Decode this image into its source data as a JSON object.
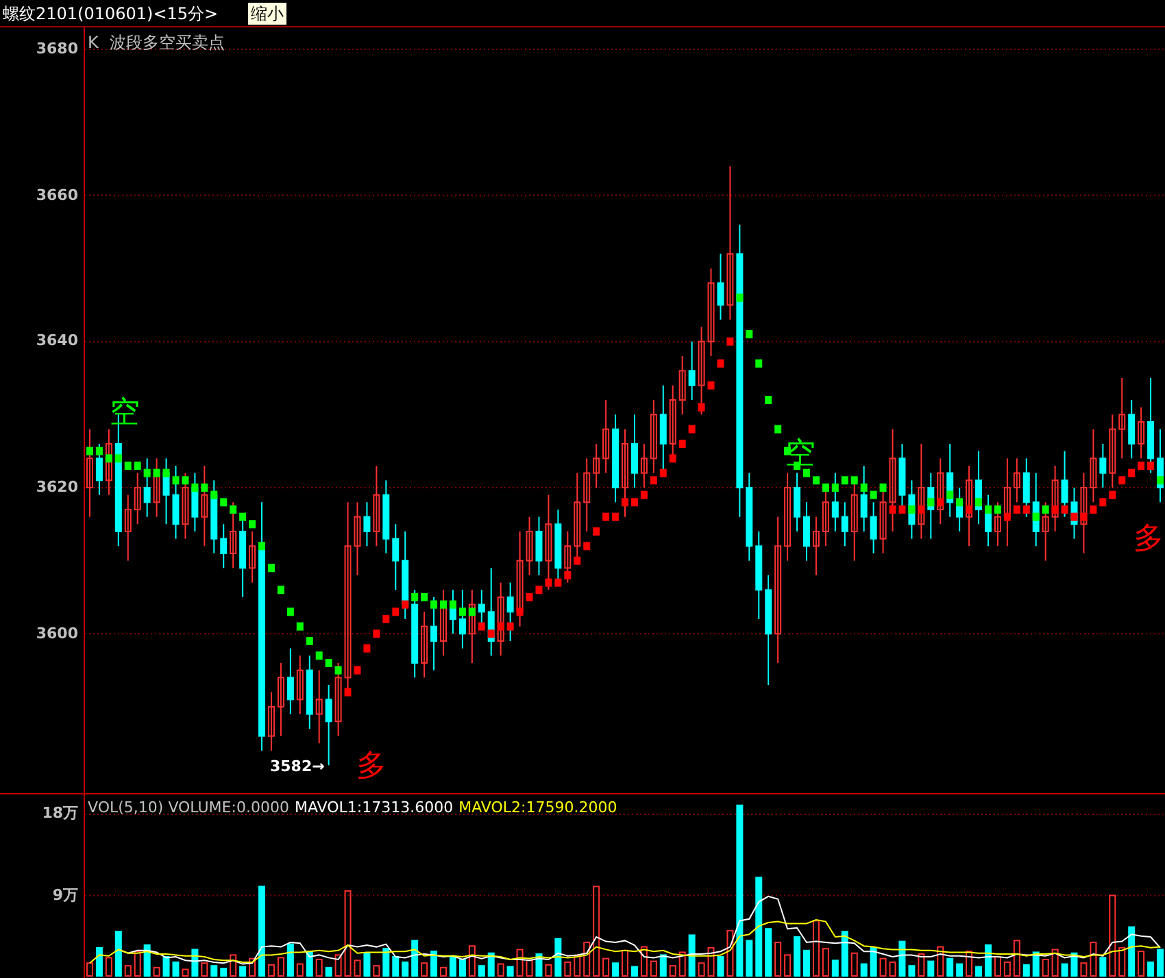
{
  "title_bar": {
    "title": "螺纹2101(010601)<15分>",
    "button": "缩小"
  },
  "price_panel": {
    "indicator_label": "K",
    "indicator_name": "波段多空买卖点",
    "low_marker": "3582→",
    "signals": [
      {
        "kind": "short",
        "text": "空"
      },
      {
        "kind": "long",
        "text": "多"
      },
      {
        "kind": "short",
        "text": "空"
      },
      {
        "kind": "long",
        "text": "多"
      }
    ],
    "chart_data": {
      "type": "candlestick",
      "ylim": [
        3578,
        3683
      ],
      "yticks": [
        3680,
        3660,
        3640,
        3620,
        3600
      ],
      "grid": true,
      "series": [
        {
          "type": "scatter",
          "color": "#00ff00",
          "values": [
            3625,
            3625,
            3624,
            3624,
            3623,
            3623,
            3622,
            3622,
            3622,
            3621,
            3621,
            3620,
            3620,
            3619,
            3618,
            3617,
            3616,
            3615,
            3612,
            3609,
            3606,
            3603,
            3601,
            3599,
            3597,
            3596,
            3595,
            null,
            null,
            null,
            null,
            null,
            null,
            null,
            3605,
            3605,
            3604,
            3604,
            3604,
            3603,
            3603,
            null,
            null,
            null,
            null,
            null,
            null,
            null,
            null,
            null,
            null,
            null,
            null,
            null,
            null,
            null,
            null,
            null,
            null,
            null,
            null,
            null,
            null,
            null,
            null,
            null,
            null,
            null,
            3646,
            3641,
            3637,
            3632,
            3628,
            3625,
            3623,
            3622,
            3621,
            3620,
            3620,
            3621,
            3621,
            3620,
            3619,
            3620,
            null,
            null,
            3617,
            null,
            3618,
            null,
            3619,
            3618,
            null,
            3618,
            3617,
            3617,
            null,
            null,
            null,
            3616,
            3617,
            null,
            null,
            null,
            null,
            null,
            null,
            null,
            null,
            null,
            null,
            null,
            3621
          ]
        },
        {
          "type": "scatter",
          "color": "#ff0000",
          "values": [
            null,
            null,
            null,
            null,
            null,
            null,
            null,
            null,
            null,
            null,
            null,
            null,
            null,
            null,
            null,
            null,
            null,
            null,
            null,
            null,
            null,
            null,
            null,
            null,
            null,
            null,
            null,
            3592,
            3595,
            3598,
            3600,
            3602,
            3603,
            3604,
            null,
            null,
            null,
            null,
            null,
            null,
            null,
            3601,
            3600,
            3601,
            3601,
            3603,
            3605,
            3606,
            3607,
            3607,
            3608,
            3610,
            3612,
            3614,
            3616,
            3616,
            3618,
            3618,
            3619,
            3621,
            3622,
            3624,
            3626,
            3628,
            3631,
            3634,
            3637,
            3640,
            null,
            null,
            null,
            null,
            null,
            null,
            null,
            null,
            null,
            null,
            null,
            null,
            null,
            null,
            null,
            null,
            3617,
            3617,
            null,
            3617,
            null,
            3618,
            null,
            null,
            3617,
            null,
            null,
            null,
            3616,
            3617,
            3617,
            null,
            null,
            3617,
            3617,
            3616,
            3616,
            3617,
            3618,
            3619,
            3621,
            3622,
            3623,
            3623,
            null
          ]
        }
      ],
      "ohlc": [
        [
          3620,
          3628,
          3616,
          3624
        ],
        [
          3624,
          3626,
          3619,
          3621
        ],
        [
          3621,
          3628,
          3619,
          3626
        ],
        [
          3626,
          3630,
          3612,
          3614
        ],
        [
          3614,
          3619,
          3610,
          3617
        ],
        [
          3617,
          3622,
          3615,
          3620
        ],
        [
          3620,
          3624,
          3616,
          3618
        ],
        [
          3618,
          3624,
          3616,
          3622
        ],
        [
          3622,
          3624,
          3615,
          3619
        ],
        [
          3619,
          3623,
          3613,
          3615
        ],
        [
          3615,
          3622,
          3613,
          3620
        ],
        [
          3620,
          3622,
          3614,
          3616
        ],
        [
          3616,
          3623,
          3612,
          3619
        ],
        [
          3619,
          3621,
          3611,
          3613
        ],
        [
          3613,
          3615,
          3609,
          3611
        ],
        [
          3611,
          3618,
          3609,
          3614
        ],
        [
          3614,
          3616,
          3605,
          3609
        ],
        [
          3609,
          3614,
          3607,
          3612
        ],
        [
          3612,
          3618,
          3584,
          3586
        ],
        [
          3586,
          3592,
          3584,
          3590
        ],
        [
          3590,
          3596,
          3586,
          3594
        ],
        [
          3594,
          3598,
          3589,
          3591
        ],
        [
          3591,
          3597,
          3589,
          3595
        ],
        [
          3595,
          3597,
          3587,
          3589
        ],
        [
          3589,
          3595,
          3585,
          3591
        ],
        [
          3591,
          3593,
          3582,
          3588
        ],
        [
          3588,
          3596,
          3586,
          3594
        ],
        [
          3594,
          3618,
          3592,
          3612
        ],
        [
          3612,
          3618,
          3608,
          3616
        ],
        [
          3616,
          3618,
          3612,
          3614
        ],
        [
          3614,
          3623,
          3612,
          3619
        ],
        [
          3619,
          3621,
          3611,
          3613
        ],
        [
          3613,
          3615,
          3606,
          3610
        ],
        [
          3610,
          3614,
          3602,
          3604
        ],
        [
          3604,
          3606,
          3594,
          3596
        ],
        [
          3596,
          3603,
          3594,
          3601
        ],
        [
          3601,
          3605,
          3595,
          3599
        ],
        [
          3599,
          3606,
          3597,
          3604
        ],
        [
          3604,
          3606,
          3600,
          3602
        ],
        [
          3602,
          3606,
          3598,
          3600
        ],
        [
          3600,
          3606,
          3596,
          3604
        ],
        [
          3604,
          3606,
          3601,
          3603
        ],
        [
          3603,
          3609,
          3597,
          3599
        ],
        [
          3599,
          3607,
          3597,
          3605
        ],
        [
          3605,
          3607,
          3599,
          3603
        ],
        [
          3603,
          3614,
          3601,
          3610
        ],
        [
          3610,
          3616,
          3608,
          3614
        ],
        [
          3614,
          3616,
          3608,
          3610
        ],
        [
          3610,
          3619,
          3606,
          3615
        ],
        [
          3615,
          3617,
          3607,
          3609
        ],
        [
          3609,
          3614,
          3607,
          3612
        ],
        [
          3612,
          3622,
          3610,
          3618
        ],
        [
          3618,
          3624,
          3614,
          3622
        ],
        [
          3622,
          3626,
          3620,
          3624
        ],
        [
          3624,
          3632,
          3622,
          3628
        ],
        [
          3628,
          3630,
          3618,
          3620
        ],
        [
          3620,
          3628,
          3616,
          3626
        ],
        [
          3626,
          3630,
          3620,
          3622
        ],
        [
          3622,
          3626,
          3620,
          3624
        ],
        [
          3624,
          3632,
          3622,
          3630
        ],
        [
          3630,
          3634,
          3622,
          3626
        ],
        [
          3626,
          3634,
          3624,
          3632
        ],
        [
          3632,
          3638,
          3630,
          3636
        ],
        [
          3636,
          3640,
          3632,
          3634
        ],
        [
          3634,
          3642,
          3630,
          3640
        ],
        [
          3640,
          3650,
          3638,
          3648
        ],
        [
          3648,
          3652,
          3643,
          3645
        ],
        [
          3645,
          3664,
          3643,
          3652
        ],
        [
          3652,
          3656,
          3616,
          3620
        ],
        [
          3620,
          3622,
          3610,
          3612
        ],
        [
          3612,
          3614,
          3602,
          3606
        ],
        [
          3606,
          3608,
          3593,
          3600
        ],
        [
          3600,
          3616,
          3596,
          3612
        ],
        [
          3612,
          3622,
          3610,
          3620
        ],
        [
          3620,
          3622,
          3614,
          3616
        ],
        [
          3616,
          3618,
          3610,
          3612
        ],
        [
          3612,
          3616,
          3608,
          3614
        ],
        [
          3614,
          3620,
          3612,
          3618
        ],
        [
          3618,
          3622,
          3614,
          3616
        ],
        [
          3616,
          3618,
          3612,
          3614
        ],
        [
          3614,
          3621,
          3610,
          3619
        ],
        [
          3619,
          3623,
          3614,
          3616
        ],
        [
          3616,
          3618,
          3611,
          3613
        ],
        [
          3613,
          3620,
          3611,
          3618
        ],
        [
          3618,
          3628,
          3614,
          3624
        ],
        [
          3624,
          3626,
          3617,
          3619
        ],
        [
          3619,
          3621,
          3613,
          3615
        ],
        [
          3615,
          3626,
          3613,
          3620
        ],
        [
          3620,
          3622,
          3613,
          3617
        ],
        [
          3617,
          3624,
          3615,
          3622
        ],
        [
          3622,
          3626,
          3616,
          3618
        ],
        [
          3618,
          3620,
          3614,
          3616
        ],
        [
          3616,
          3623,
          3612,
          3621
        ],
        [
          3621,
          3625,
          3615,
          3617
        ],
        [
          3617,
          3619,
          3612,
          3614
        ],
        [
          3614,
          3618,
          3612,
          3616
        ],
        [
          3616,
          3624,
          3612,
          3620
        ],
        [
          3620,
          3624,
          3618,
          3622
        ],
        [
          3622,
          3624,
          3616,
          3618
        ],
        [
          3618,
          3622,
          3612,
          3614
        ],
        [
          3614,
          3618,
          3610,
          3616
        ],
        [
          3616,
          3623,
          3614,
          3621
        ],
        [
          3621,
          3625,
          3616,
          3618
        ],
        [
          3618,
          3620,
          3613,
          3615
        ],
        [
          3615,
          3622,
          3611,
          3620
        ],
        [
          3620,
          3628,
          3618,
          3624
        ],
        [
          3624,
          3626,
          3620,
          3622
        ],
        [
          3622,
          3630,
          3620,
          3628
        ],
        [
          3628,
          3635,
          3624,
          3630
        ],
        [
          3630,
          3632,
          3624,
          3626
        ],
        [
          3626,
          3631,
          3624,
          3629
        ],
        [
          3629,
          3635,
          3622,
          3624
        ],
        [
          3624,
          3628,
          3618,
          3620
        ]
      ]
    }
  },
  "volume_panel": {
    "legend": [
      {
        "text": "VOL(5,10) VOLUME:0.0000",
        "color": "#c0c0c0"
      },
      {
        "text": "MAVOL1:17313.6000",
        "color": "#ffffff"
      },
      {
        "text": "MAVOL2:17590.2000",
        "color": "#ffff00"
      }
    ],
    "chart_data": {
      "type": "bar",
      "ylim": [
        0,
        20.2
      ],
      "yticks": [
        {
          "value": 18,
          "label": "18万"
        },
        {
          "value": 9,
          "label": "9万"
        }
      ],
      "grid": true,
      "colors": [
        "#ff3030",
        "#00ffff",
        "#ff3030",
        "#00ffff",
        "#ff3030",
        "#ff3030",
        "#00ffff",
        "#ff3030",
        "#00ffff",
        "#00ffff",
        "#ff3030",
        "#00ffff",
        "#ff3030",
        "#00ffff",
        "#00ffff",
        "#ff3030",
        "#00ffff",
        "#ff3030",
        "#00ffff",
        "#ff3030",
        "#ff3030",
        "#00ffff",
        "#ff3030",
        "#00ffff",
        "#ff3030",
        "#00ffff",
        "#ff3030",
        "#ff3030",
        "#ff3030",
        "#00ffff",
        "#ff3030",
        "#00ffff",
        "#00ffff",
        "#00ffff",
        "#00ffff",
        "#ff3030",
        "#00ffff",
        "#ff3030",
        "#00ffff",
        "#00ffff",
        "#ff3030",
        "#00ffff",
        "#00ffff",
        "#ff3030",
        "#00ffff",
        "#ff3030",
        "#ff3030",
        "#00ffff",
        "#ff3030",
        "#00ffff",
        "#ff3030",
        "#ff3030",
        "#ff3030",
        "#ff3030",
        "#ff3030",
        "#00ffff",
        "#ff3030",
        "#00ffff",
        "#ff3030",
        "#ff3030",
        "#00ffff",
        "#ff3030",
        "#ff3030",
        "#00ffff",
        "#ff3030",
        "#ff3030",
        "#00ffff",
        "#ff3030",
        "#00ffff",
        "#00ffff",
        "#00ffff",
        "#00ffff",
        "#ff3030",
        "#ff3030",
        "#00ffff",
        "#00ffff",
        "#ff3030",
        "#ff3030",
        "#00ffff",
        "#00ffff",
        "#ff3030",
        "#00ffff",
        "#00ffff",
        "#ff3030",
        "#ff3030",
        "#00ffff",
        "#00ffff",
        "#ff3030",
        "#00ffff",
        "#ff3030",
        "#00ffff",
        "#00ffff",
        "#ff3030",
        "#00ffff",
        "#00ffff",
        "#ff3030",
        "#ff3030",
        "#ff3030",
        "#00ffff",
        "#00ffff",
        "#ff3030",
        "#ff3030",
        "#00ffff",
        "#00ffff",
        "#ff3030",
        "#ff3030",
        "#00ffff",
        "#ff3030",
        "#ff3030",
        "#00ffff",
        "#ff3030",
        "#00ffff",
        "#00ffff"
      ],
      "series": [
        {
          "type": "line",
          "color": "#ffffff",
          "values": [
            null,
            null,
            null,
            3.0,
            2.6,
            2.9,
            2.9,
            2.7,
            2.1,
            2.2,
            1.8,
            1.7,
            1.8,
            1.6,
            1.5,
            1.8,
            1.4,
            1.5,
            3.3,
            3.4,
            3.3,
            3.8,
            3.7,
            2.2,
            2.4,
            2.1,
            1.9,
            3.5,
            3.3,
            3.5,
            3.3,
            3.6,
            2.2,
            2.1,
            2.4,
            2.5,
            2.4,
            2.2,
            2.3,
            1.9,
            2.3,
            2.0,
            2.3,
            2.1,
            1.9,
            1.9,
            1.8,
            2.0,
            1.9,
            2.6,
            2.3,
            2.4,
            2.6,
            4.4,
            3.9,
            3.8,
            4.0,
            3.5,
            2.2,
            2.1,
            2.3,
            2.1,
            2.3,
            2.5,
            2.5,
            2.6,
            2.8,
            3.3,
            6.2,
            6.4,
            8.3,
            8.9,
            8.6,
            5.3,
            5.4,
            3.8,
            3.9,
            3.8,
            3.7,
            3.8,
            3.7,
            2.8,
            2.8,
            2.5,
            2.2,
            2.4,
            2.4,
            2.2,
            2.2,
            2.5,
            2.3,
            2.3,
            2.2,
            2.1,
            2.2,
            2.2,
            2.1,
            2.5,
            2.4,
            2.4,
            2.3,
            2.6,
            2.1,
            2.3,
            2.1,
            2.5,
            2.3,
            3.8,
            3.9,
            4.7,
            4.5,
            4.4,
            3.2
          ]
        },
        {
          "type": "line",
          "color": "#ffff00",
          "values": [
            1.5,
            2.4,
            2.3,
            3.0,
            2.6,
            2.6,
            2.8,
            2.5,
            2.5,
            2.4,
            2.3,
            2.3,
            2.2,
            1.9,
            1.8,
            1.8,
            1.6,
            1.6,
            2.4,
            2.4,
            2.5,
            2.7,
            2.7,
            2.8,
            2.9,
            2.8,
            2.9,
            3.5,
            2.6,
            2.7,
            2.7,
            2.7,
            2.8,
            2.8,
            3.0,
            2.3,
            2.4,
            2.3,
            2.3,
            2.2,
            2.4,
            2.3,
            2.3,
            2.2,
            1.9,
            2.1,
            2.0,
            2.2,
            2.1,
            2.2,
            2.1,
            2.2,
            2.4,
            3.3,
            3.0,
            2.8,
            2.9,
            2.8,
            3.0,
            2.8,
            2.9,
            2.5,
            2.4,
            2.3,
            2.3,
            2.3,
            2.4,
            2.9,
            4.5,
            4.7,
            5.6,
            6.0,
            6.1,
            5.9,
            5.9,
            5.9,
            6.3,
            6.1,
            4.4,
            4.5,
            4.0,
            3.4,
            3.3,
            3.1,
            3.0,
            3.0,
            3.0,
            2.9,
            2.9,
            2.8,
            2.7,
            2.7,
            2.7,
            2.6,
            2.6,
            2.5,
            2.5,
            2.5,
            2.3,
            2.5,
            2.5,
            2.6,
            2.4,
            2.4,
            2.2,
            2.4,
            2.4,
            2.8,
            2.9,
            3.3,
            3.4,
            3.2,
            3.3
          ]
        }
      ],
      "values": [
        1.5,
        3.2,
        2.1,
        5.0,
        1.2,
        2.8,
        3.5,
        1.0,
        2.2,
        1.6,
        0.8,
        3.0,
        1.5,
        1.2,
        0.9,
        2.4,
        1.1,
        2.0,
        10.0,
        1.3,
        2.1,
        3.6,
        1.4,
        2.8,
        1.9,
        1.0,
        2.4,
        9.5,
        1.8,
        2.6,
        1.2,
        3.1,
        2.2,
        1.6,
        4.0,
        1.5,
        2.8,
        1.0,
        2.3,
        1.9,
        3.4,
        1.2,
        2.6,
        1.4,
        1.1,
        3.0,
        1.8,
        2.5,
        1.3,
        4.2,
        1.6,
        2.3,
        3.8,
        10.0,
        2.0,
        1.5,
        2.9,
        1.1,
        3.3,
        1.7,
        2.4,
        1.2,
        2.7,
        4.6,
        1.5,
        3.2,
        2.2,
        5.1,
        19.0,
        4.0,
        11.0,
        5.3,
        3.8,
        2.4,
        4.4,
        2.9,
        6.2,
        3.1,
        1.8,
        5.0,
        2.6,
        1.4,
        3.2,
        2.0,
        1.6,
        3.9,
        1.2,
        2.5,
        1.7,
        3.3,
        2.0,
        1.4,
        2.8,
        1.1,
        3.5,
        2.2,
        1.6,
        4.0,
        1.3,
        2.7,
        1.9,
        3.0,
        1.4,
        2.6,
        1.5,
        3.8,
        2.1,
        9.0,
        3.2,
        5.5,
        2.8,
        1.6,
        3.0
      ]
    }
  }
}
